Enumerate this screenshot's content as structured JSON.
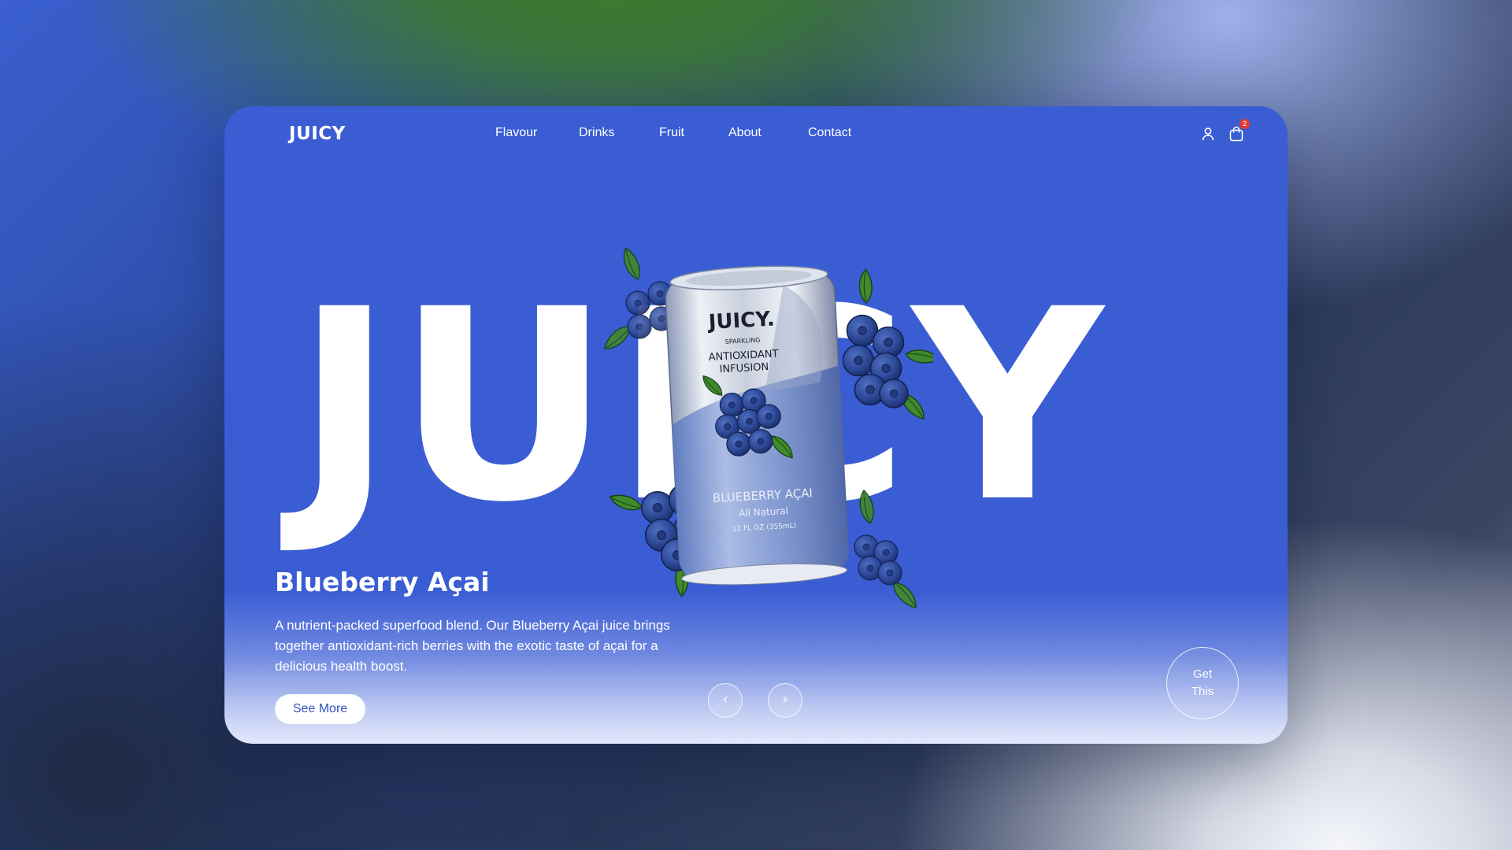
{
  "brand": {
    "logo": "JUICY",
    "hero_word": "JUICY"
  },
  "nav": {
    "items": [
      "Flavour",
      "Drinks",
      "Fruit",
      "About",
      "Contact"
    ]
  },
  "header_icons": {
    "account_icon": "user-icon",
    "cart_icon": "shopping-bag-icon",
    "cart_count": "2"
  },
  "product": {
    "title": "Blueberry Açai",
    "description": "A nutrient-packed superfood blend. Our Blueberry Açai juice brings together antioxidant-rich berries with the exotic taste of açai for a delicious health boost.",
    "can": {
      "brand": "JUICY.",
      "line1": "SPARKLING",
      "line2": "ANTIOXIDANT",
      "line3": "INFUSION",
      "flavor": "BLUEBERRY AÇAI",
      "tagline": "All Natural",
      "volume": "12 FL OZ (355mL)"
    }
  },
  "actions": {
    "see_more": "See More",
    "get_this": "Get\nThis",
    "prev_icon": "chevron-left-icon",
    "next_icon": "chevron-right-icon"
  },
  "colors": {
    "accent": "#3a5dd4",
    "badge": "#e53935",
    "berry": "#2f4f9c",
    "leaf": "#3f8a2c"
  }
}
